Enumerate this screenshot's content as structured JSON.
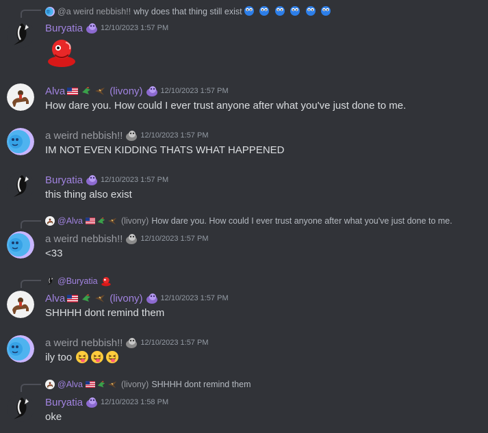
{
  "users": {
    "buryatia": "Buryatia",
    "alva": "Alva",
    "alva_suffix": "(livony)",
    "nebbish": "a weird nebbish!!"
  },
  "messages": [
    {
      "reply_name": "@a weird nebbish!!",
      "reply_text": "why does that thing still exist",
      "author": "Buryatia",
      "time": "12/10/2023 1:57 PM",
      "content": ""
    },
    {
      "author": "Alva",
      "author_suffix": "(livony)",
      "time": "12/10/2023 1:57 PM",
      "content": "How dare you. How could I ever trust anyone after what you've just done to me."
    },
    {
      "author": "a weird nebbish!!",
      "time": "12/10/2023 1:57 PM",
      "content": "IM NOT EVEN KIDDING THATS WHAT HAPPENED"
    },
    {
      "author": "Buryatia",
      "time": "12/10/2023 1:57 PM",
      "content": "this thing also exist"
    },
    {
      "reply_name": "@Alva",
      "reply_suffix": "(livony)",
      "reply_text": "How dare you. How could I ever trust anyone after what you've just done to me.",
      "author": "a weird nebbish!!",
      "time": "12/10/2023 1:57 PM",
      "content": "<33"
    },
    {
      "reply_name": "@Buryatia",
      "author": "Alva",
      "author_suffix": "(livony)",
      "time": "12/10/2023 1:57 PM",
      "content": "SHHHH dont remind them"
    },
    {
      "author": "a weird nebbish!!",
      "time": "12/10/2023 1:57 PM",
      "content": "ily too"
    },
    {
      "reply_name": "@Alva",
      "reply_suffix": "(livony)",
      "reply_text": "SHHHH dont remind them",
      "author": "Buryatia",
      "time": "12/10/2023 1:58 PM",
      "content": "oke"
    }
  ],
  "colors": {
    "background": "#313338",
    "role_purple": "#a183e0",
    "name_gray": "#9a9ca2",
    "text": "#dbdee1",
    "timestamp": "#949ba4"
  },
  "icons": {
    "buryatia_avatar": "black-white-bird-avatar",
    "alva_avatar": "figure-on-camel-avatar",
    "nebbish_avatar": "blue-purple-orb-avatar",
    "purple_badge": "purple-blob-icon",
    "gray_badge": "gray-blob-icon",
    "flag": "us-flag-icon"
  }
}
